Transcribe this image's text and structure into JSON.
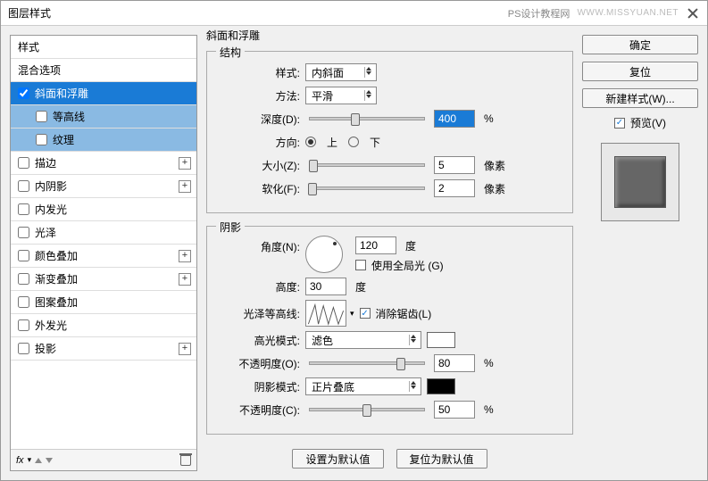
{
  "title": "图层样式",
  "watermark_left": "PS设计教程网",
  "watermark_right": "WWW.MISSYUAN.NET",
  "styles_header": "样式",
  "blend_options": "混合选项",
  "style_items": [
    {
      "label": "斜面和浮雕",
      "checked": true,
      "selected": true,
      "expandable": false
    },
    {
      "label": "等高线",
      "checked": false,
      "sub": true,
      "subselected": true
    },
    {
      "label": "纹理",
      "checked": false,
      "sub": true,
      "subselected": true
    },
    {
      "label": "描边",
      "checked": false,
      "expandable": true
    },
    {
      "label": "内阴影",
      "checked": false,
      "expandable": true
    },
    {
      "label": "内发光",
      "checked": false
    },
    {
      "label": "光泽",
      "checked": false
    },
    {
      "label": "颜色叠加",
      "checked": false,
      "expandable": true
    },
    {
      "label": "渐变叠加",
      "checked": false,
      "expandable": true
    },
    {
      "label": "图案叠加",
      "checked": false
    },
    {
      "label": "外发光",
      "checked": false
    },
    {
      "label": "投影",
      "checked": false,
      "expandable": true
    }
  ],
  "fx_label": "fx",
  "panel_title": "斜面和浮雕",
  "structure": {
    "legend": "结构",
    "style_label": "样式:",
    "style_value": "内斜面",
    "method_label": "方法:",
    "method_value": "平滑",
    "depth_label": "深度(D):",
    "depth_value": "400",
    "percent": "%",
    "direction_label": "方向:",
    "dir_up": "上",
    "dir_down": "下",
    "size_label": "大小(Z):",
    "size_value": "5",
    "px": "像素",
    "soften_label": "软化(F):",
    "soften_value": "2"
  },
  "shading": {
    "legend": "阴影",
    "angle_label": "角度(N):",
    "angle_value": "120",
    "deg": "度",
    "global_light": "使用全局光 (G)",
    "altitude_label": "高度:",
    "altitude_value": "30",
    "gloss_label": "光泽等高线:",
    "antialias": "消除锯齿(L)",
    "highlight_mode_label": "高光模式:",
    "highlight_mode_value": "滤色",
    "opacity_label": "不透明度(O):",
    "opacity_hi": "80",
    "shadow_mode_label": "阴影模式:",
    "shadow_mode_value": "正片叠底",
    "opacity_label2": "不透明度(C):",
    "opacity_sh": "50"
  },
  "buttons": {
    "make_default": "设置为默认值",
    "reset_default": "复位为默认值",
    "ok": "确定",
    "cancel": "复位",
    "new_style": "新建样式(W)...",
    "preview": "预览(V)"
  }
}
